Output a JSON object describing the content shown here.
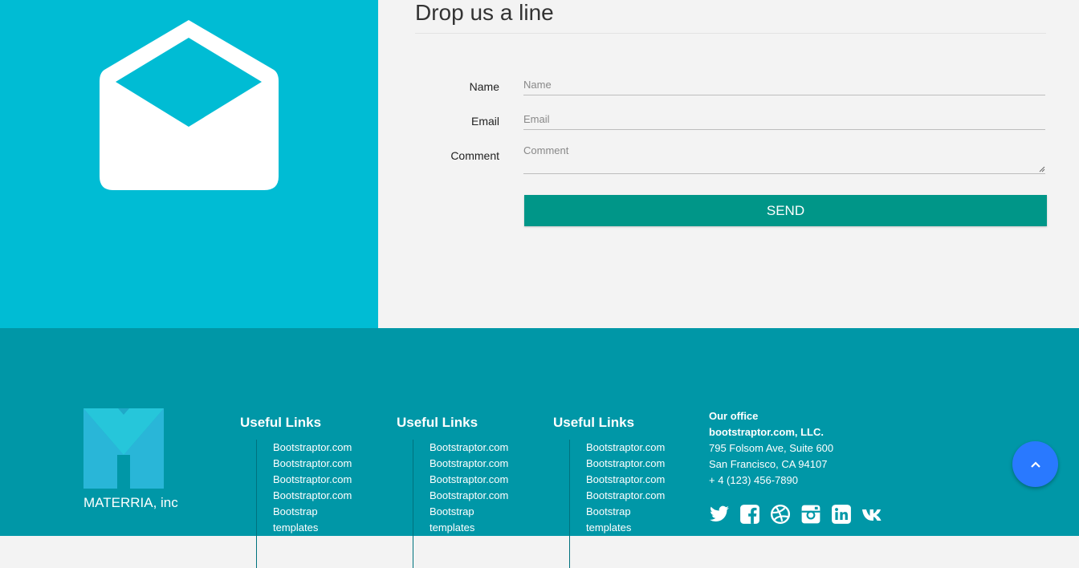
{
  "contact": {
    "heading": "Drop us a line",
    "fields": [
      {
        "label": "Name",
        "placeholder": "Name"
      },
      {
        "label": "Email",
        "placeholder": "Email"
      },
      {
        "label": "Comment",
        "placeholder": "Comment"
      }
    ],
    "send_label": "SEND"
  },
  "footer": {
    "brand": "MATERRIA, inc",
    "columns": [
      {
        "title": "Useful Links",
        "links": [
          "Bootstraptor.com",
          "Bootstraptor.com",
          "Bootstraptor.com",
          "Bootstraptor.com",
          "Bootstrap templates"
        ]
      },
      {
        "title": "Useful Links",
        "links": [
          "Bootstraptor.com",
          "Bootstraptor.com",
          "Bootstraptor.com",
          "Bootstraptor.com",
          "Bootstrap templates"
        ]
      },
      {
        "title": "Useful Links",
        "links": [
          "Bootstraptor.com",
          "Bootstraptor.com",
          "Bootstraptor.com",
          "Bootstraptor.com",
          "Bootstrap templates"
        ]
      }
    ],
    "office": {
      "title": "Our office",
      "company": "bootstraptor.com, LLC.",
      "address1": "795 Folsom Ave, Suite 600",
      "address2": "San Francisco, CA 94107",
      "phone": "+ 4 (123) 456-7890"
    },
    "social": [
      "twitter-icon",
      "facebook-icon",
      "dribbble-icon",
      "instagram-icon",
      "linkedin-icon",
      "vk-icon"
    ]
  },
  "colors": {
    "cyan": "#00bcd4",
    "teal": "#009688",
    "footer": "#0097a7",
    "fab": "#2979ff"
  }
}
